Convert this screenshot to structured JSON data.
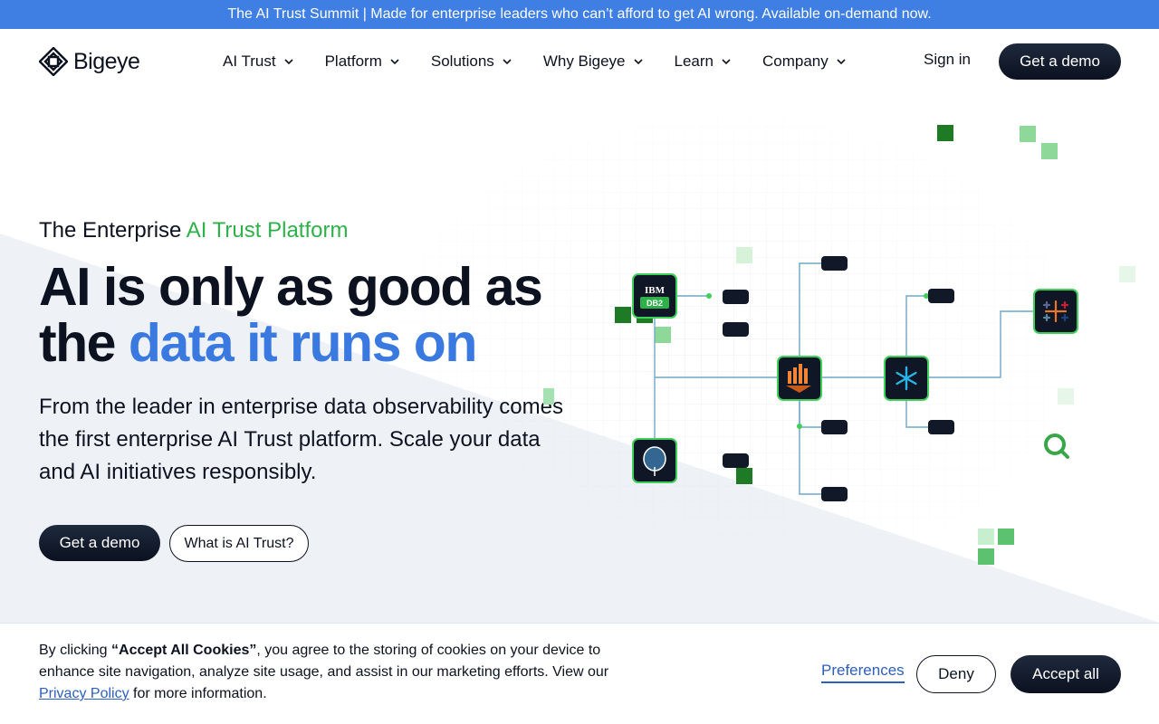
{
  "banner": {
    "text": "The AI Trust Summit | Made for enterprise leaders who can’t afford to get AI wrong. Available on-demand now."
  },
  "header": {
    "logo_text": "Bigeye",
    "nav": [
      {
        "label": "AI Trust"
      },
      {
        "label": "Platform"
      },
      {
        "label": "Solutions"
      },
      {
        "label": "Why Bigeye"
      },
      {
        "label": "Learn"
      },
      {
        "label": "Company"
      }
    ],
    "signin_label": "Sign in",
    "demo_label": "Get a demo"
  },
  "hero": {
    "eyebrow_prefix": "The Enterprise ",
    "eyebrow_accent": "AI Trust Platform",
    "headline_line1": "AI is only as good as",
    "headline_line2_prefix": "the ",
    "headline_line2_accent": "data it runs on",
    "subtext": "From the leader in enterprise data observability comes the first enterprise AI Trust platform. Scale your data and AI initiatives responsibly.",
    "primary_label": "Get a demo",
    "secondary_label": "What is AI Trust?",
    "diagram_labels": {
      "ibm": "IBM",
      "db2": "DB2"
    }
  },
  "cookie": {
    "text_prefix": "By clicking ",
    "text_bold": "“Accept All Cookies”",
    "text_middle": ", you agree to the storing of cookies on your device to enhance site navigation, analyze site usage, and assist in our marketing efforts. View our ",
    "link_label": "Privacy Policy",
    "text_suffix": " for more information.",
    "preferences_label": "Preferences",
    "deny_label": "Deny",
    "accept_label": "Accept all"
  },
  "colors": {
    "banner": "#3f7ee3",
    "accent_green": "#2fb14a",
    "accent_blue": "#3a79df",
    "dark_button": "#0b1120",
    "link": "#2c5fbf"
  }
}
